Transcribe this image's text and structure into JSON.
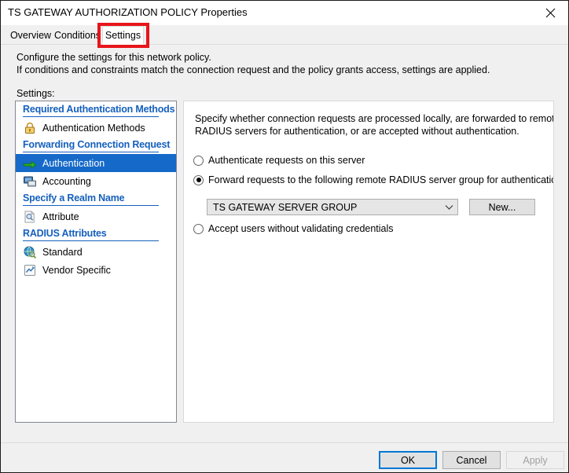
{
  "window": {
    "title": "TS GATEWAY AUTHORIZATION POLICY Properties",
    "close_icon": "close-icon"
  },
  "tabs": [
    {
      "label": "Overview",
      "active": false
    },
    {
      "label": "Conditions",
      "active": false
    },
    {
      "label": "Settings",
      "active": true,
      "highlighted": true
    }
  ],
  "description": {
    "line1": "Configure the settings for this network policy.",
    "line2": "If conditions and constraints match the connection request and the policy grants access, settings are applied."
  },
  "settings_label": "Settings:",
  "tree": {
    "groups": [
      {
        "title": "Required Authentication Methods",
        "items": [
          {
            "label": "Authentication Methods",
            "icon": "padlock-icon",
            "selected": false
          }
        ]
      },
      {
        "title": "Forwarding Connection Request",
        "items": [
          {
            "label": "Authentication",
            "icon": "green-arrow-icon",
            "selected": true
          },
          {
            "label": "Accounting",
            "icon": "computers-icon",
            "selected": false
          }
        ]
      },
      {
        "title": "Specify a Realm Name",
        "items": [
          {
            "label": "Attribute",
            "icon": "document-magnifier-icon",
            "selected": false
          }
        ]
      },
      {
        "title": "RADIUS Attributes",
        "items": [
          {
            "label": "Standard",
            "icon": "globe-magnifier-icon",
            "selected": false
          },
          {
            "label": "Vendor Specific",
            "icon": "checkbox-pencil-icon",
            "selected": false
          }
        ]
      }
    ]
  },
  "content": {
    "description_line1": "Specify whether connection requests are processed locally, are forwarded to remote",
    "description_line2": "RADIUS servers for authentication, or are accepted without authentication.",
    "options": [
      {
        "label": "Authenticate requests on this server",
        "selected": false
      },
      {
        "label": "Forward requests to the following remote RADIUS server group for authentication:",
        "selected": true
      },
      {
        "label": "Accept users without validating credentials",
        "selected": false
      }
    ],
    "server_group": {
      "selected_value": "TS GATEWAY SERVER GROUP",
      "dropdown_icon": "chevron-down-icon",
      "new_button_label": "New..."
    }
  },
  "footer": {
    "ok_label": "OK",
    "cancel_label": "Cancel",
    "apply_label": "Apply"
  },
  "colors": {
    "selection_blue": "#1569c9",
    "group_header_blue": "#1560bd",
    "focus_blue": "#0078d7",
    "annotation_red": "#e8151a"
  }
}
